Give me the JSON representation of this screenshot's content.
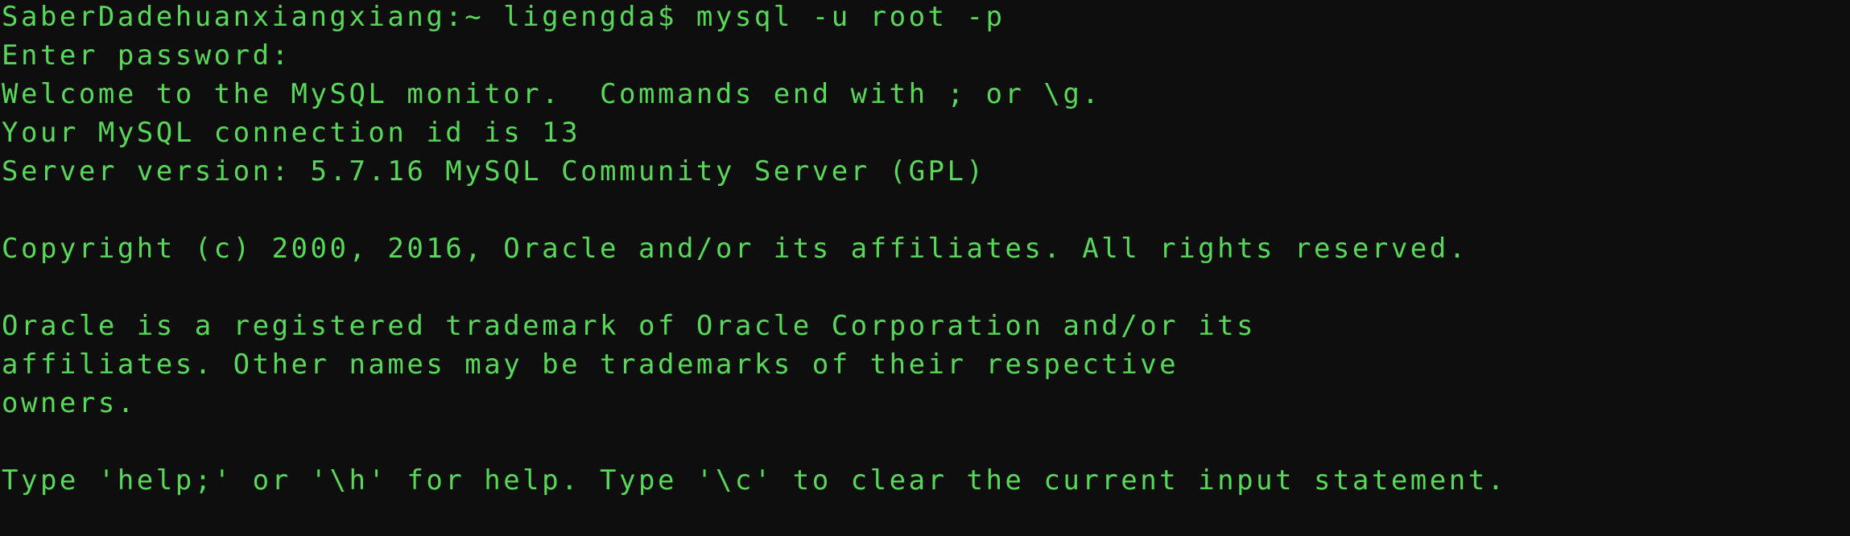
{
  "terminal": {
    "lines": [
      "SaberDadehuanxiangxiang:~ ligengda$ mysql -u root -p",
      "Enter password:",
      "Welcome to the MySQL monitor.  Commands end with ; or \\g.",
      "Your MySQL connection id is 13",
      "Server version: 5.7.16 MySQL Community Server (GPL)",
      "",
      "Copyright (c) 2000, 2016, Oracle and/or its affiliates. All rights reserved.",
      "",
      "Oracle is a registered trademark of Oracle Corporation and/or its",
      "affiliates. Other names may be trademarks of their respective",
      "owners.",
      "",
      "Type 'help;' or '\\h' for help. Type '\\c' to clear the current input statement."
    ]
  },
  "colors": {
    "background": "#0e0e0e",
    "text": "#58d858"
  }
}
